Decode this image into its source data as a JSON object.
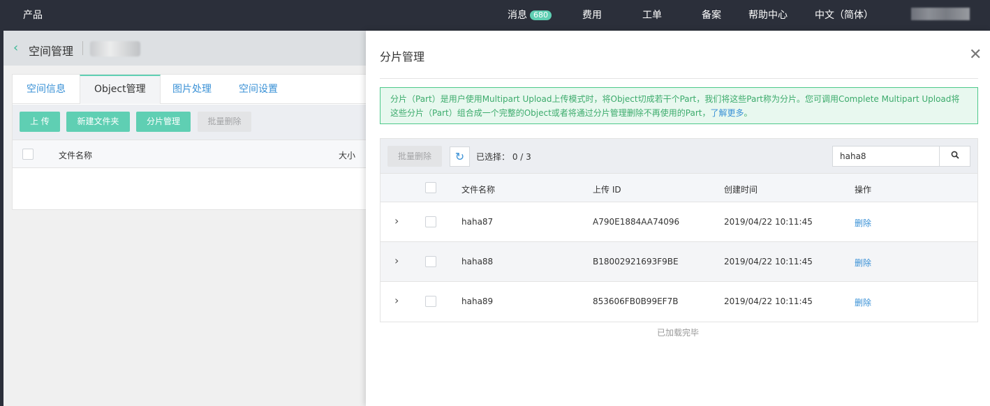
{
  "topnav": {
    "product": "产品",
    "messages_label": "消息",
    "messages_count": "680",
    "billing": "费用",
    "tickets": "工单",
    "filing": "备案",
    "help": "帮助中心",
    "language": "中文（简体）"
  },
  "page": {
    "title": "空间管理",
    "tabs": [
      "空间信息",
      "Object管理",
      "图片处理",
      "空间设置"
    ],
    "toolbar": {
      "upload": "上 传",
      "new_folder": "新建文件夹",
      "part_manage": "分片管理",
      "batch_delete": "批量删除"
    },
    "table_header": {
      "name": "文件名称",
      "size": "大小"
    }
  },
  "drawer": {
    "title": "分片管理",
    "info_text": "分片（Part）是用户使用Multipart Upload上传模式时，将Object切成若干个Part，我们将这些Part称为分片。您可调用Complete Multipart Upload将这些分片（Part）组合成一个完整的Object或者将通过分片管理删除不再使用的Part，",
    "info_link": "了解更多",
    "info_end": "。",
    "batch_delete": "批量删除",
    "selected_label": "已选择：",
    "selected_value": "0 / 3",
    "search_value": "haha8",
    "columns": {
      "name": "文件名称",
      "upload_id": "上传 ID",
      "created": "创建时间",
      "action": "操作"
    },
    "rows": [
      {
        "name": "haha87",
        "upload_id": "A790E1884AA74096",
        "created": "2019/04/22 10:11:45",
        "action": "删除"
      },
      {
        "name": "haha88",
        "upload_id": "B18002921693F9BE",
        "created": "2019/04/22 10:11:45",
        "action": "删除"
      },
      {
        "name": "haha89",
        "upload_id": "853606FB0B99EF7B",
        "created": "2019/04/22 10:11:45",
        "action": "删除"
      }
    ],
    "loaded_text": "已加载完毕"
  },
  "colors": {
    "accent": "#5fcfb3",
    "link": "#3a91d6",
    "nav_bg": "#2b2f3a",
    "info_border": "#4dc98a"
  }
}
